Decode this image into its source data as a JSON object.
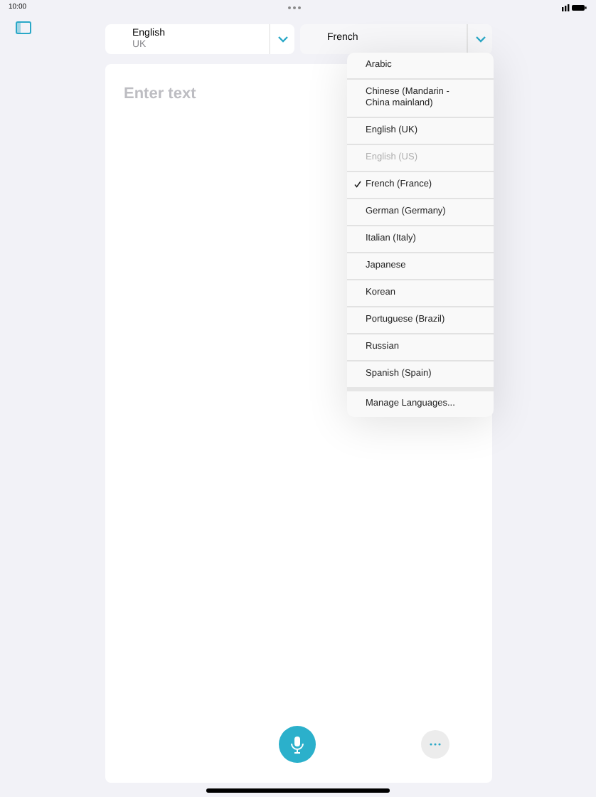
{
  "status_bar": {
    "time": "10:00"
  },
  "source_language": {
    "name": "English",
    "region": "UK"
  },
  "target_language": {
    "name": "French",
    "expanded": true
  },
  "input": {
    "placeholder": "Enter text"
  },
  "language_menu": {
    "items": [
      {
        "label": "Arabic",
        "selected": false,
        "disabled": false
      },
      {
        "label": "Chinese (Mandarin - China mainland)",
        "selected": false,
        "disabled": false
      },
      {
        "label": "English (UK)",
        "selected": false,
        "disabled": false
      },
      {
        "label": "English (US)",
        "selected": false,
        "disabled": true
      },
      {
        "label": "French (France)",
        "selected": true,
        "disabled": false
      },
      {
        "label": "German (Germany)",
        "selected": false,
        "disabled": false
      },
      {
        "label": "Italian (Italy)",
        "selected": false,
        "disabled": false
      },
      {
        "label": "Japanese",
        "selected": false,
        "disabled": false
      },
      {
        "label": "Korean",
        "selected": false,
        "disabled": false
      },
      {
        "label": "Portuguese (Brazil)",
        "selected": false,
        "disabled": false
      },
      {
        "label": "Russian",
        "selected": false,
        "disabled": false
      },
      {
        "label": "Spanish (Spain)",
        "selected": false,
        "disabled": false
      }
    ],
    "footer": "Manage Languages..."
  }
}
